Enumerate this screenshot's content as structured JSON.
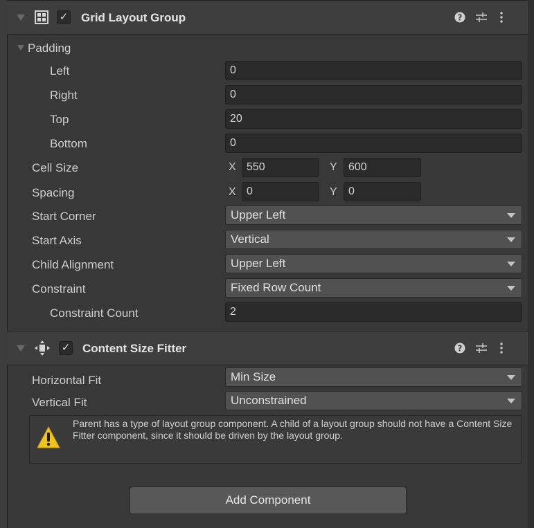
{
  "grid_layout": {
    "title": "Grid Layout Group",
    "enabled_check": "✓",
    "padding_label": "Padding",
    "padding": [
      {
        "label": "Left",
        "value": "0"
      },
      {
        "label": "Right",
        "value": "0"
      },
      {
        "label": "Top",
        "value": "20"
      },
      {
        "label": "Bottom",
        "value": "0"
      }
    ],
    "cell_size": {
      "label": "Cell Size",
      "x_axis": "X",
      "x": "550",
      "y_axis": "Y",
      "y": "600"
    },
    "spacing": {
      "label": "Spacing",
      "x_axis": "X",
      "x": "0",
      "y_axis": "Y",
      "y": "0"
    },
    "start_corner": {
      "label": "Start Corner",
      "value": "Upper Left"
    },
    "start_axis": {
      "label": "Start Axis",
      "value": "Vertical"
    },
    "child_alignment": {
      "label": "Child Alignment",
      "value": "Upper Left"
    },
    "constraint": {
      "label": "Constraint",
      "value": "Fixed Row Count"
    },
    "constraint_count": {
      "label": "Constraint Count",
      "value": "2"
    }
  },
  "content_size_fitter": {
    "title": "Content Size Fitter",
    "enabled_check": "✓",
    "horizontal_fit": {
      "label": "Horizontal Fit",
      "value": "Min Size"
    },
    "vertical_fit": {
      "label": "Vertical Fit",
      "value": "Unconstrained"
    },
    "warning": "Parent has a type of layout group component. A child of a layout group should not have a Content Size Fitter component, since it should be driven by the layout group."
  },
  "icons": {
    "help": "help-icon",
    "presets": "presets-icon",
    "menu": "kebab-menu-icon",
    "grid": "grid-layout-icon",
    "fitter": "content-size-fitter-icon",
    "warning": "warning-icon"
  },
  "add_component_label": "Add Component",
  "colors": {
    "background": "#383838",
    "header": "#3e3e3e",
    "field": "#2a2a2a",
    "dropdown": "#515151",
    "warning": "#f0c419"
  }
}
